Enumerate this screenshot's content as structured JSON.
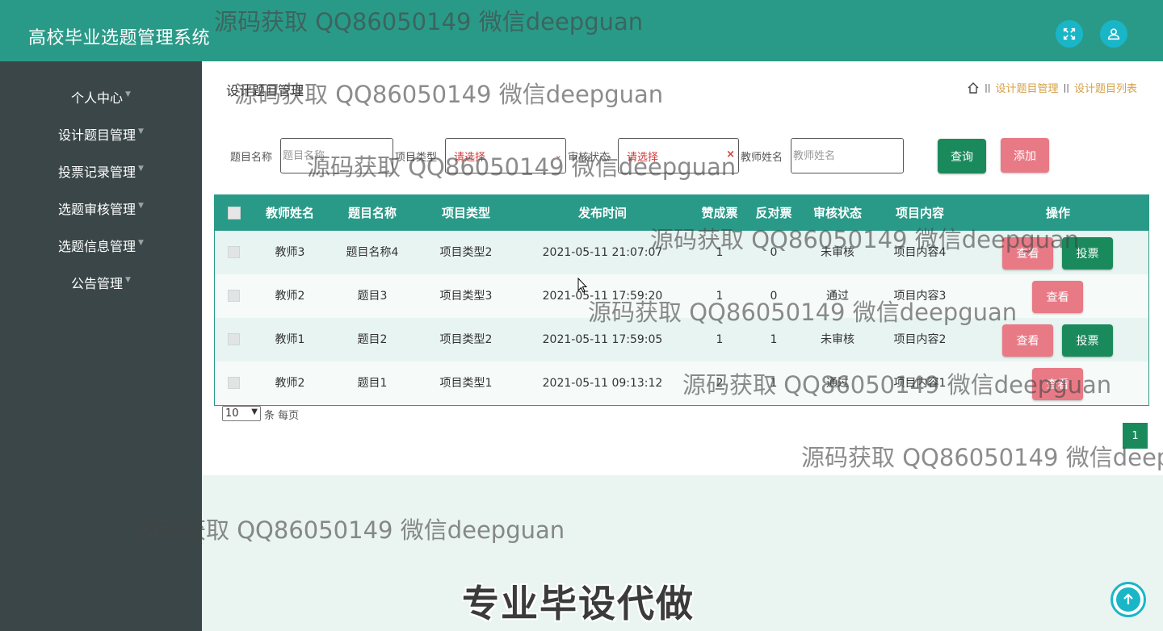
{
  "header": {
    "app_title": "高校毕业选题管理系统",
    "fullscreen_icon": "expand-arrows-icon",
    "user_icon": "user-icon"
  },
  "sidebar": {
    "items": [
      {
        "label": "个人中心"
      },
      {
        "label": "设计题目管理"
      },
      {
        "label": "投票记录管理"
      },
      {
        "label": "选题审核管理"
      },
      {
        "label": "选题信息管理"
      },
      {
        "label": "公告管理"
      }
    ]
  },
  "page": {
    "title": "设计题目管理",
    "breadcrumb": [
      "设计题目管理",
      "设计题目列表"
    ]
  },
  "filters": {
    "title_label": "题目名称",
    "title_placeholder": "题目名称",
    "type_label": "项目类型",
    "type_placeholder": "请选择",
    "status_label": "审核状态",
    "status_placeholder": "请选择",
    "teacher_label": "教师姓名",
    "teacher_placeholder": "教师姓名",
    "query_button": "查询",
    "add_button": "添加"
  },
  "table": {
    "headers": [
      "教师姓名",
      "题目名称",
      "项目类型",
      "发布时间",
      "赞成票",
      "反对票",
      "审核状态",
      "项目内容",
      "操作"
    ],
    "rows": [
      {
        "teacher": "教师3",
        "title": "题目名称4",
        "type": "项目类型2",
        "time": "2021-05-11 21:07:07",
        "yes": "1",
        "no": "0",
        "status": "未审核",
        "content": "项目内容4",
        "actions": [
          "查看",
          "投票"
        ]
      },
      {
        "teacher": "教师2",
        "title": "题目3",
        "type": "项目类型3",
        "time": "2021-05-11 17:59:20",
        "yes": "1",
        "no": "0",
        "status": "通过",
        "content": "项目内容3",
        "actions": [
          "查看"
        ]
      },
      {
        "teacher": "教师1",
        "title": "题目2",
        "type": "项目类型2",
        "time": "2021-05-11 17:59:05",
        "yes": "1",
        "no": "1",
        "status": "未审核",
        "content": "项目内容2",
        "actions": [
          "查看",
          "投票"
        ]
      },
      {
        "teacher": "教师2",
        "title": "题目1",
        "type": "项目类型1",
        "time": "2021-05-11 09:13:12",
        "yes": "2",
        "no": "1",
        "status": "通过",
        "content": "项目内容1",
        "actions": [
          "查看"
        ]
      }
    ]
  },
  "pagination": {
    "page_size": "10",
    "page_size_suffix": "条 每页",
    "current_page": "1"
  },
  "overlays": {
    "watermark": "源码获取 QQ86050149 微信deepguan",
    "slogan": "专业毕设代做"
  },
  "colors": {
    "header": "#2a9a88",
    "sidebar": "#3a4647",
    "accent_green": "#1a8a5c",
    "accent_pink": "#e87a86",
    "breadcrumb_link": "#d4a147"
  }
}
